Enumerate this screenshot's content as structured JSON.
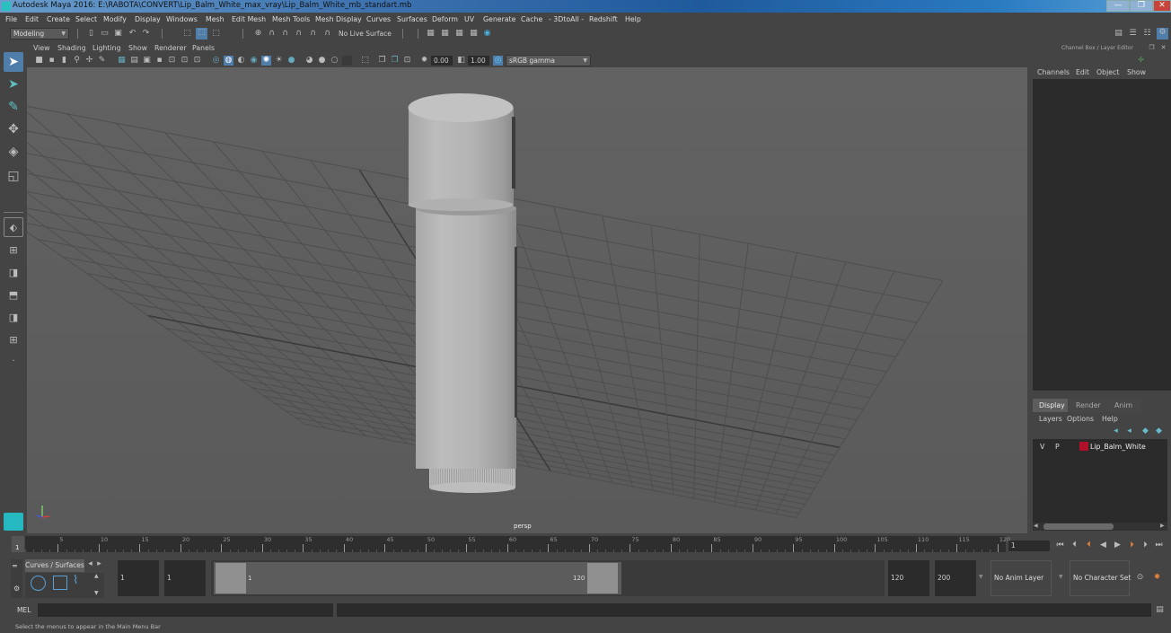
{
  "window": {
    "title": "Autodesk Maya 2016: E:\\RABOTA\\CONVERT\\Lip_Balm_White_max_vray\\Lip_Balm_White_mb_standart.mb",
    "minimize": "—",
    "maximize": "❐",
    "close": "✕"
  },
  "menubar": [
    "File",
    "Edit",
    "Create",
    "Select",
    "Modify",
    "Display",
    "Windows",
    "Mesh",
    "Edit Mesh",
    "Mesh Tools",
    "Mesh Display",
    "Curves",
    "Surfaces",
    "Deform",
    "UV",
    "Generate",
    "Cache",
    "- 3DtoAll -",
    "Redshift",
    "Help"
  ],
  "shelf": {
    "mode_menu": "Modeling",
    "live_surface": "No Live Surface"
  },
  "viewport": {
    "menu": [
      "View",
      "Shading",
      "Lighting",
      "Show",
      "Renderer",
      "Panels"
    ],
    "exposure": "0.00",
    "gamma": "1.00",
    "color_space": "sRGB gamma",
    "camera_label": "persp"
  },
  "right_panel": {
    "title": "Channel Box / Layer Editor",
    "channel_menu": [
      "Channels",
      "Edit",
      "Object",
      "Show"
    ],
    "tabs": [
      "Display",
      "Render",
      "Anim"
    ],
    "active_tab": "Display",
    "layer_menu": [
      "Layers",
      "Options",
      "Help"
    ],
    "layers": [
      {
        "visible": "V",
        "playback": "P",
        "color": "#b0102a",
        "name": "Lip_Balm_White"
      }
    ]
  },
  "timeline": {
    "ticks": [
      "5",
      "10",
      "15",
      "20",
      "25",
      "30",
      "35",
      "40",
      "45",
      "50",
      "55",
      "60",
      "65",
      "70",
      "75",
      "80",
      "85",
      "90",
      "95",
      "100",
      "105",
      "110",
      "115",
      "120"
    ],
    "current_frame_marker": "1",
    "current_frame": "1",
    "playback_controls": [
      "go-to-start",
      "step-back-key",
      "step-back-frame",
      "play-backward",
      "play-forward",
      "step-forward-frame",
      "step-forward-key",
      "go-to-end"
    ]
  },
  "range": {
    "shelf_tab": "Curves / Surfaces",
    "start_time": "1",
    "playback_start": "1",
    "range_start_label": "1",
    "range_end_label": "120",
    "playback_end": "120",
    "end_time": "200",
    "anim_layer": "No Anim Layer",
    "character_set": "No Character Set"
  },
  "command_line": {
    "label": "MEL",
    "value": ""
  },
  "status": {
    "help_text": "Select the menus to appear in the Main Menu Bar"
  }
}
